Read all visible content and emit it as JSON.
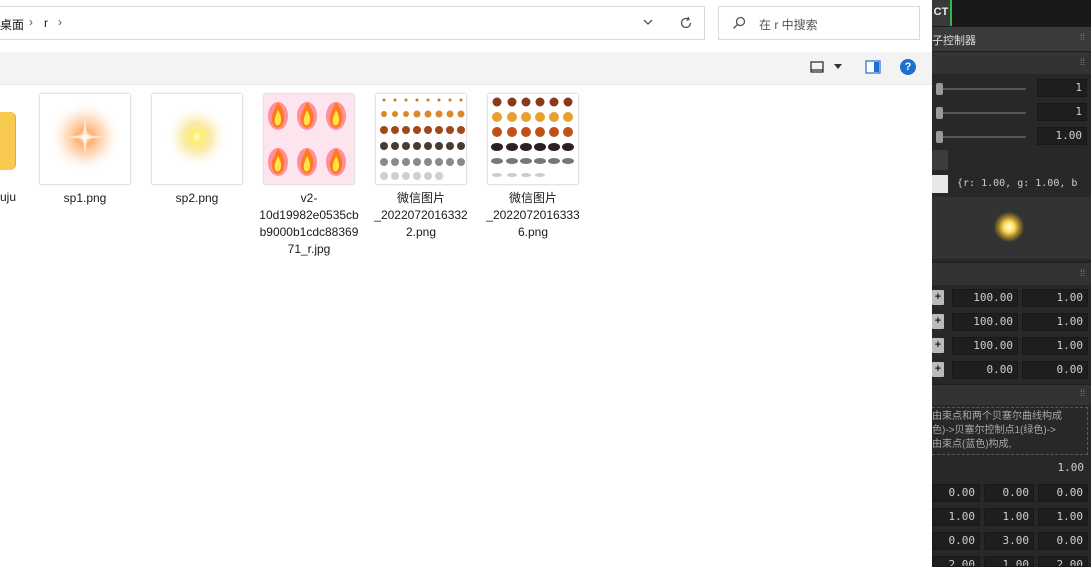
{
  "explorer": {
    "breadcrumb": [
      "桌面",
      "r"
    ],
    "search_placeholder": "在 r 中搜索",
    "folder_partial_label": "uju",
    "files": [
      {
        "name": "sp1.png",
        "thumb": "orange-glow"
      },
      {
        "name": "sp2.png",
        "thumb": "yellow-glow"
      },
      {
        "name": "v2-10d19982e0535cbb9000b1cdc8836971_r.jpg",
        "thumb": "fire-sprites"
      },
      {
        "name": "微信图片_20220720163322.png",
        "thumb": "explosion-sheet"
      },
      {
        "name": "微信图片_20220720163336.png",
        "thumb": "explosion-sheet"
      }
    ]
  },
  "unity": {
    "tab_label": "CT",
    "header1": "子控制器",
    "slider_values": [
      "1",
      "1",
      "1.00"
    ],
    "color_value": "{r: 1.00, g: 1.00, b",
    "rows": [
      {
        "a": "100.00",
        "b": "1.00"
      },
      {
        "a": "100.00",
        "b": "1.00"
      },
      {
        "a": "100.00",
        "b": "1.00"
      },
      {
        "a": "0.00",
        "b": "0.00"
      }
    ],
    "description": [
      "由束点和两个贝塞尔曲线构成",
      "色)->贝塞尔控制点1(绿色)->",
      "由束点(蓝色)构成,"
    ],
    "single_value": "1.00",
    "grid_rows": [
      [
        "0.00",
        "0.00",
        "0.00"
      ],
      [
        "1.00",
        "1.00",
        "1.00"
      ],
      [
        "0.00",
        "3.00",
        "0.00"
      ],
      [
        "2.00",
        "1.00",
        "2.00"
      ]
    ]
  }
}
